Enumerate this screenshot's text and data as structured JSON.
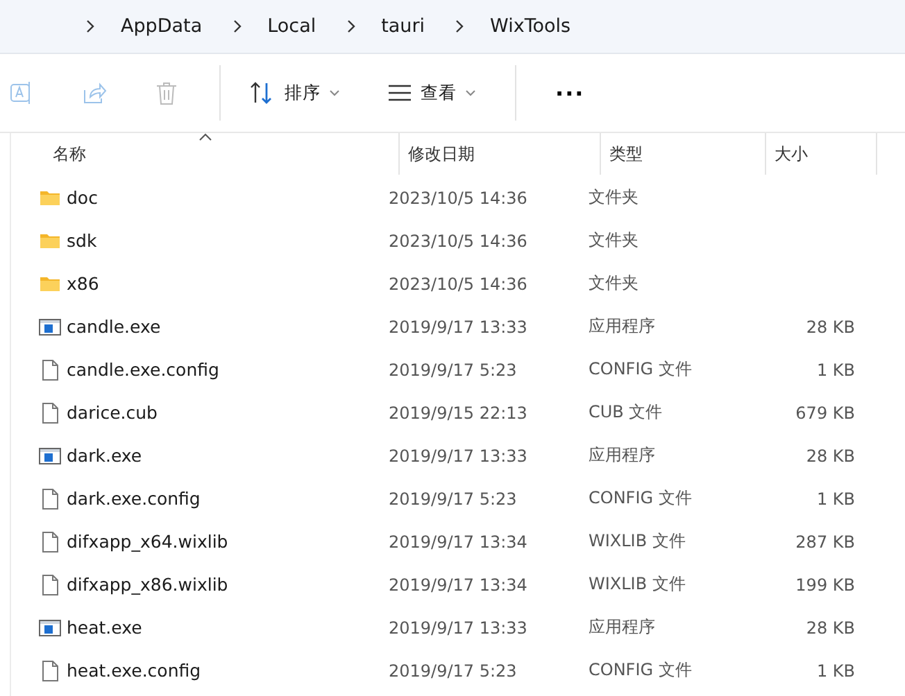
{
  "breadcrumb": [
    "AppData",
    "Local",
    "tauri",
    "WixTools"
  ],
  "toolbar": {
    "sort": "排序",
    "view": "查看",
    "more": "···"
  },
  "columns": [
    {
      "label": "名称",
      "sorted": true
    },
    {
      "label": "修改日期",
      "sorted": false
    },
    {
      "label": "类型",
      "sorted": false
    },
    {
      "label": "大小",
      "sorted": false
    }
  ],
  "rows": [
    {
      "kind": "folder",
      "name": "doc",
      "date": "2023/10/5 14:36",
      "type": "文件夹"
    },
    {
      "kind": "folder",
      "name": "sdk",
      "date": "2023/10/5 14:36",
      "type": "文件夹"
    },
    {
      "kind": "folder",
      "name": "x86",
      "date": "2023/10/5 14:36",
      "type": "文件夹"
    },
    {
      "kind": "exe",
      "name": "candle.exe",
      "date": "2019/9/17 13:33",
      "type": "应用程序",
      "size": "28 KB"
    },
    {
      "kind": "file",
      "name": "candle.exe.config",
      "date": "2019/9/17 5:23",
      "type": "CONFIG 文件",
      "size": "1 KB"
    },
    {
      "kind": "file",
      "name": "darice.cub",
      "date": "2019/9/15 22:13",
      "type": "CUB 文件",
      "size": "679 KB"
    },
    {
      "kind": "exe",
      "name": "dark.exe",
      "date": "2019/9/17 13:33",
      "type": "应用程序",
      "size": "28 KB"
    },
    {
      "kind": "file",
      "name": "dark.exe.config",
      "date": "2019/9/17 5:23",
      "type": "CONFIG 文件",
      "size": "1 KB"
    },
    {
      "kind": "file",
      "name": "difxapp_x64.wixlib",
      "date": "2019/9/17 13:34",
      "type": "WIXLIB 文件",
      "size": "287 KB"
    },
    {
      "kind": "file",
      "name": "difxapp_x86.wixlib",
      "date": "2019/9/17 13:34",
      "type": "WIXLIB 文件",
      "size": "199 KB"
    },
    {
      "kind": "exe",
      "name": "heat.exe",
      "date": "2019/9/17 13:33",
      "type": "应用程序",
      "size": "28 KB"
    },
    {
      "kind": "file",
      "name": "heat.exe.config",
      "date": "2019/9/17 5:23",
      "type": "CONFIG 文件",
      "size": "1 KB"
    }
  ]
}
